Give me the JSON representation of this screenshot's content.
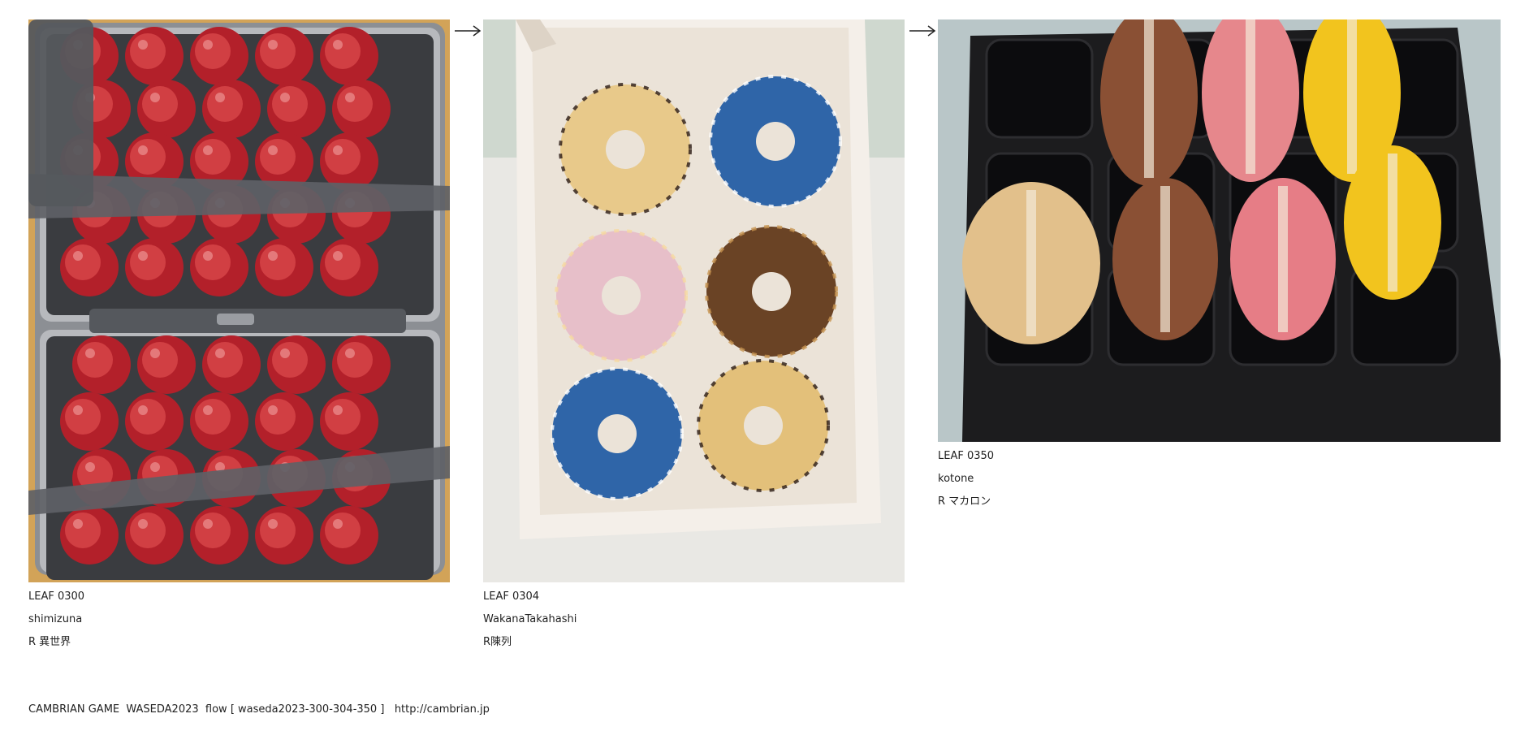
{
  "items": [
    {
      "leaf": "LEAF 0300",
      "author": "shimizuna",
      "reply": "R 異世界",
      "image": "red apples packed in an open suitcase"
    },
    {
      "leaf": "LEAF 0304",
      "author": "WakanaTakahashi",
      "reply": "R陳列",
      "image": "box of six decorated donuts"
    },
    {
      "leaf": "LEAF 0350",
      "author": "kotone",
      "reply": "R マカロン",
      "image": "macarons in a dark plastic tray"
    }
  ],
  "footer": {
    "text": "CAMBRIAN GAME  WASEDA2023  flow [ waseda2023-300-304-350 ]   ",
    "link": "http://cambrian.jp"
  },
  "colors": {
    "text": "#222222",
    "background": "#ffffff"
  }
}
